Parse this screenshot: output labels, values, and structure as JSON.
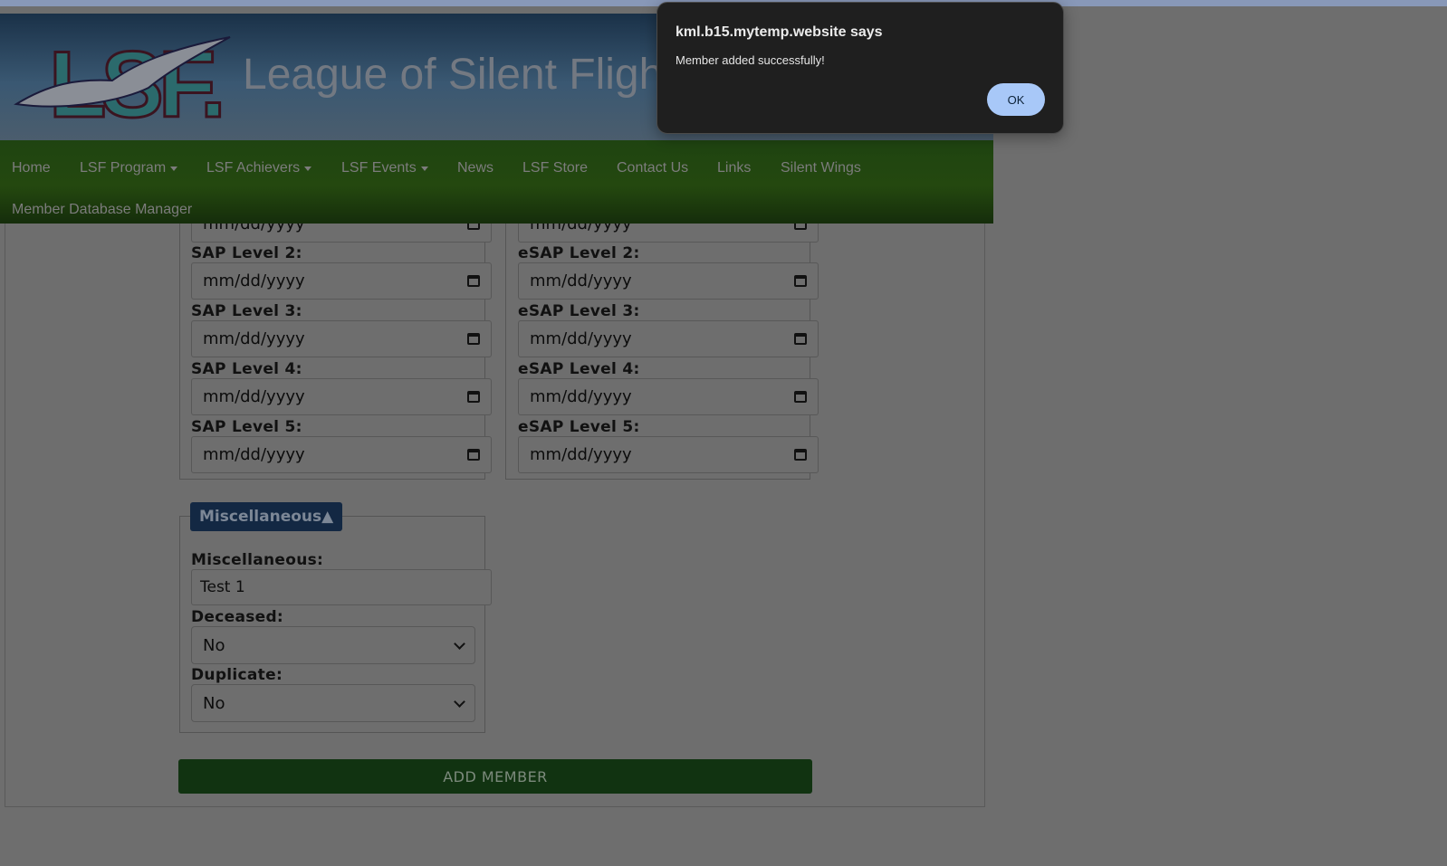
{
  "site": {
    "title": "League of Silent Fligh",
    "logo_text": "LSF."
  },
  "nav": {
    "items": [
      {
        "label": "Home",
        "dropdown": false
      },
      {
        "label": "LSF Program",
        "dropdown": true
      },
      {
        "label": "LSF Achievers",
        "dropdown": true
      },
      {
        "label": "LSF Events",
        "dropdown": true
      },
      {
        "label": "News",
        "dropdown": false
      },
      {
        "label": "LSF Store",
        "dropdown": false
      },
      {
        "label": "Contact Us",
        "dropdown": false
      },
      {
        "label": "Links",
        "dropdown": false
      },
      {
        "label": "Silent Wings",
        "dropdown": false
      },
      {
        "label": "Member Database Manager",
        "dropdown": false
      }
    ]
  },
  "sap": {
    "date_placeholder": "mm/dd/yyyy",
    "fields": [
      {
        "label": "SAP Level 2:",
        "value": "mm/dd/yyyy"
      },
      {
        "label": "SAP Level 3:",
        "value": "mm/dd/yyyy"
      },
      {
        "label": "SAP Level 4:",
        "value": "mm/dd/yyyy"
      },
      {
        "label": "SAP Level 5:",
        "value": "mm/dd/yyyy"
      }
    ]
  },
  "esap": {
    "fields": [
      {
        "label": "eSAP Level 2:",
        "value": "mm/dd/yyyy"
      },
      {
        "label": "eSAP Level 3:",
        "value": "mm/dd/yyyy"
      },
      {
        "label": "eSAP Level 4:",
        "value": "mm/dd/yyyy"
      },
      {
        "label": "eSAP Level 5:",
        "value": "mm/dd/yyyy"
      }
    ]
  },
  "misc": {
    "legend": "Miscellaneous▲",
    "misc_label": "Miscellaneous:",
    "misc_value": "Test 1",
    "deceased_label": "Deceased:",
    "deceased_value": "No",
    "duplicate_label": "Duplicate:",
    "duplicate_value": "No"
  },
  "add_member_label": "ADD MEMBER",
  "alert": {
    "title": "kml.b15.mytemp.website says",
    "message": "Member added successfully!",
    "ok_label": "OK"
  },
  "colors": {
    "overlay": "#6e6e6e",
    "nav_green": "#24480f",
    "header_blue": "#1a3148",
    "legend_navy": "#132843",
    "add_button_green": "#113311",
    "ok_button_blue": "#a8c8f8",
    "dialog_bg": "#1f1f1f"
  },
  "icons": [
    "calendar-icon",
    "chevron-down-icon",
    "caret-down-icon",
    "seagull-logo-icon"
  ]
}
